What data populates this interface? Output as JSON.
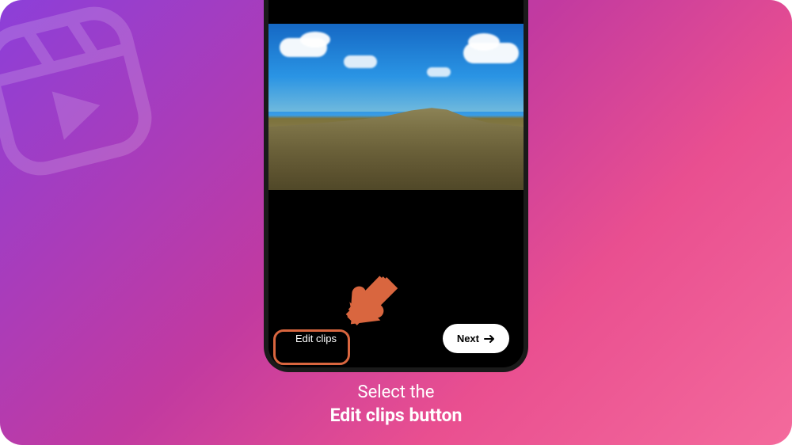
{
  "buttons": {
    "edit_clips": "Edit clips",
    "next": "Next"
  },
  "caption": {
    "line1": "Select the",
    "line2": "Edit clips button"
  },
  "icons": {
    "reels": "reels-icon",
    "arrow_right": "arrow-right-icon",
    "pointer": "pointer-arrow-icon"
  },
  "colors": {
    "highlight": "#d9663f",
    "pointer": "#d9663f"
  }
}
